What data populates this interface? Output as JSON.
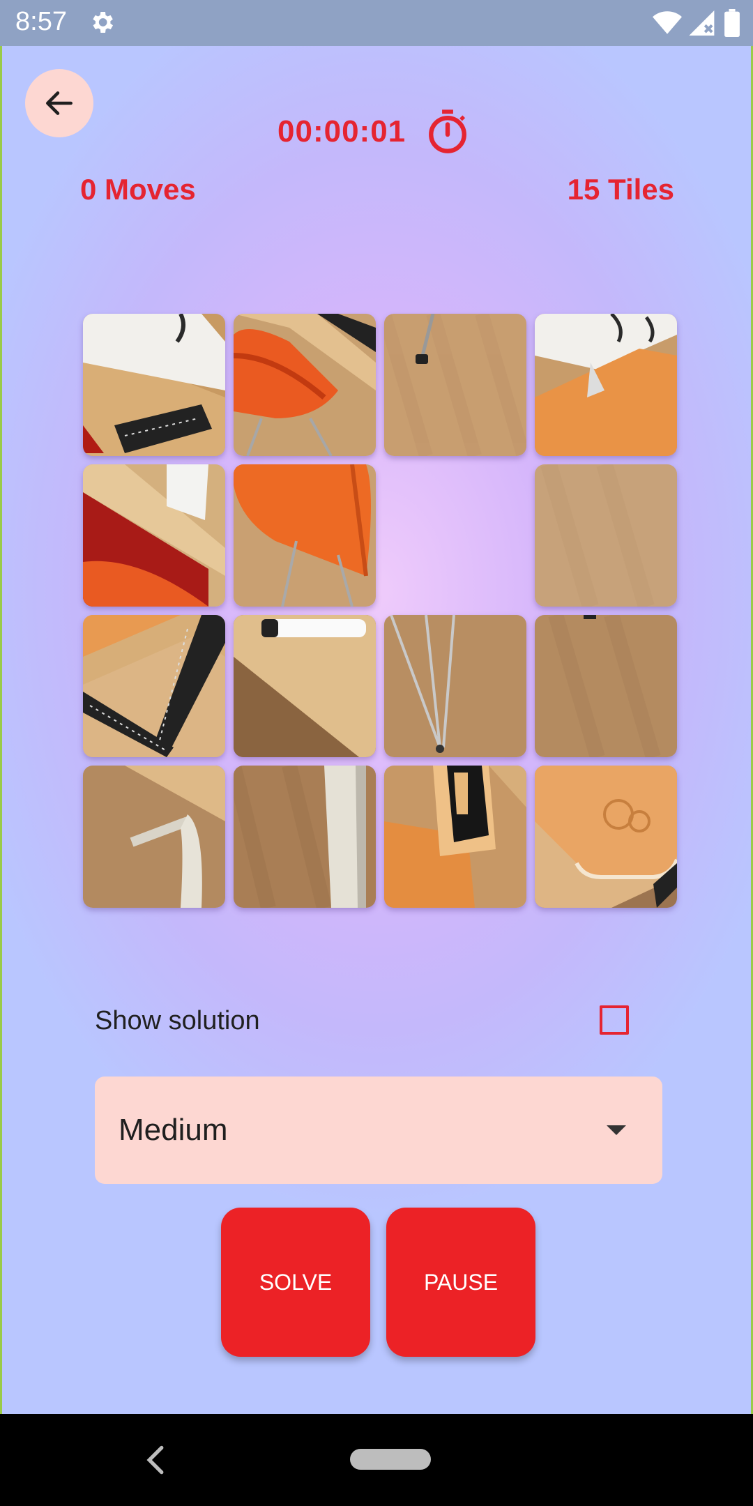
{
  "status_bar": {
    "time": "8:57"
  },
  "header": {
    "timer": "00:00:01",
    "moves": "0 Moves",
    "tiles": "15 Tiles"
  },
  "board": {
    "grid": 4,
    "empty_index": 6,
    "tiles": [
      {
        "desc": "paper-ruler"
      },
      {
        "desc": "orange-chair-ruler"
      },
      {
        "desc": "floor-leg"
      },
      {
        "desc": "paper-notebook"
      },
      {
        "desc": "orange-chair-paper"
      },
      {
        "desc": "orange-chair"
      },
      {
        "desc": "empty"
      },
      {
        "desc": "floor"
      },
      {
        "desc": "square-ruler"
      },
      {
        "desc": "marker-desk"
      },
      {
        "desc": "floor-legs"
      },
      {
        "desc": "floor-dark"
      },
      {
        "desc": "desk-leg"
      },
      {
        "desc": "desk-leg-floor"
      },
      {
        "desc": "phone-notebook"
      },
      {
        "desc": "notebook-corner"
      }
    ]
  },
  "controls": {
    "show_solution_label": "Show solution",
    "show_solution_checked": false,
    "difficulty_value": "Medium",
    "solve_label": "SOLVE",
    "pause_label": "PAUSE"
  },
  "colors": {
    "accent": "#e52431",
    "button": "#ec2226",
    "chip": "#fdd7d2"
  }
}
